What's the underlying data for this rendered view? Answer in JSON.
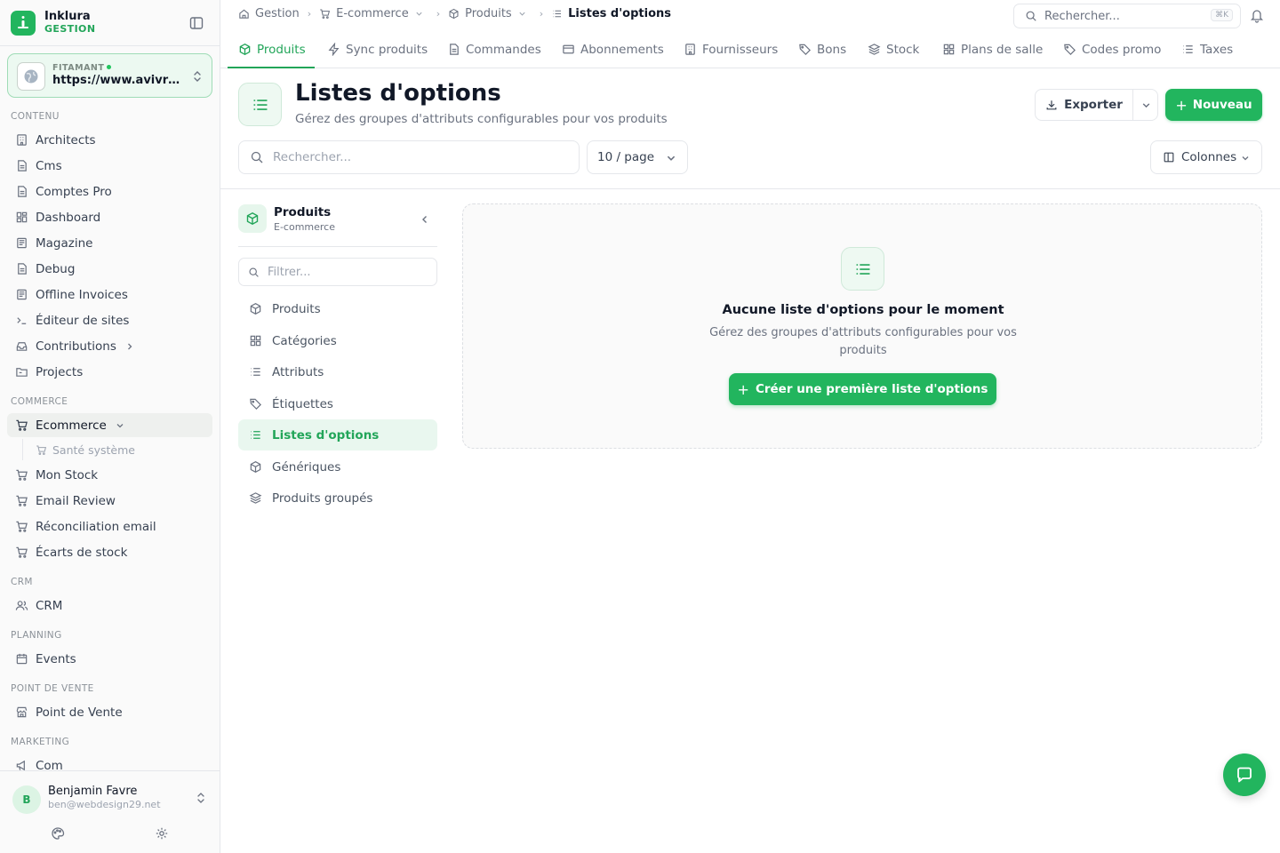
{
  "brand": {
    "name": "Inklura",
    "sub": "GESTION"
  },
  "site": {
    "label": "FITAMANT",
    "url": "https://www.avivre-fitamant.fr"
  },
  "sidebar": {
    "sections": {
      "contenu": "CONTENU",
      "commerce": "COMMERCE",
      "crm": "CRM",
      "planning": "PLANNING",
      "pos": "POINT DE VENTE",
      "marketing": "MARKETING"
    },
    "contenu_items": [
      "Architects",
      "Cms",
      "Comptes Pro",
      "Dashboard",
      "Magazine",
      "Debug",
      "Offline Invoices",
      "Éditeur de sites",
      "Contributions",
      "Projects"
    ],
    "commerce_active": "Ecommerce",
    "commerce_sub": "Santé système",
    "commerce_items": [
      "Mon Stock",
      "Email Review",
      "Réconciliation email",
      "Écarts de stock"
    ],
    "crm_item": "CRM",
    "planning_item": "Events",
    "pos_item": "Point de Vente",
    "marketing_item": "Com"
  },
  "user": {
    "initial": "B",
    "name": "Benjamin Favre",
    "email": "ben@webdesign29.net"
  },
  "breadcrumb": {
    "home": "Gestion",
    "ecommerce": "E-commerce",
    "products": "Produits",
    "current": "Listes d'options"
  },
  "search": {
    "placeholder": "Rechercher...",
    "shortcut": "⌘K"
  },
  "tabs": [
    "Produits",
    "Sync produits",
    "Commandes",
    "Abonnements",
    "Fournisseurs",
    "Bons",
    "Stock",
    "Plans de salle",
    "Codes promo",
    "Taxes"
  ],
  "header": {
    "title": "Listes d'options",
    "subtitle": "Gérez des groupes d'attributs configurables pour vos produits",
    "export_label": "Exporter",
    "new_label": "Nouveau"
  },
  "toolbar": {
    "search_placeholder": "Rechercher...",
    "page_size": "10 / page",
    "columns_label": "Colonnes"
  },
  "subnav": {
    "title": "Produits",
    "subtitle": "E-commerce",
    "filter_placeholder": "Filtrer...",
    "items": [
      "Produits",
      "Catégories",
      "Attributs",
      "Étiquettes",
      "Listes d'options",
      "Génériques",
      "Produits groupés"
    ]
  },
  "empty": {
    "title": "Aucune liste d'options pour le moment",
    "description": "Gérez des groupes d'attributs configurables pour vos produits",
    "cta": "Créer une première liste d'options"
  },
  "colors": {
    "accent": "#22b55e",
    "accent_text": "#22a559"
  }
}
